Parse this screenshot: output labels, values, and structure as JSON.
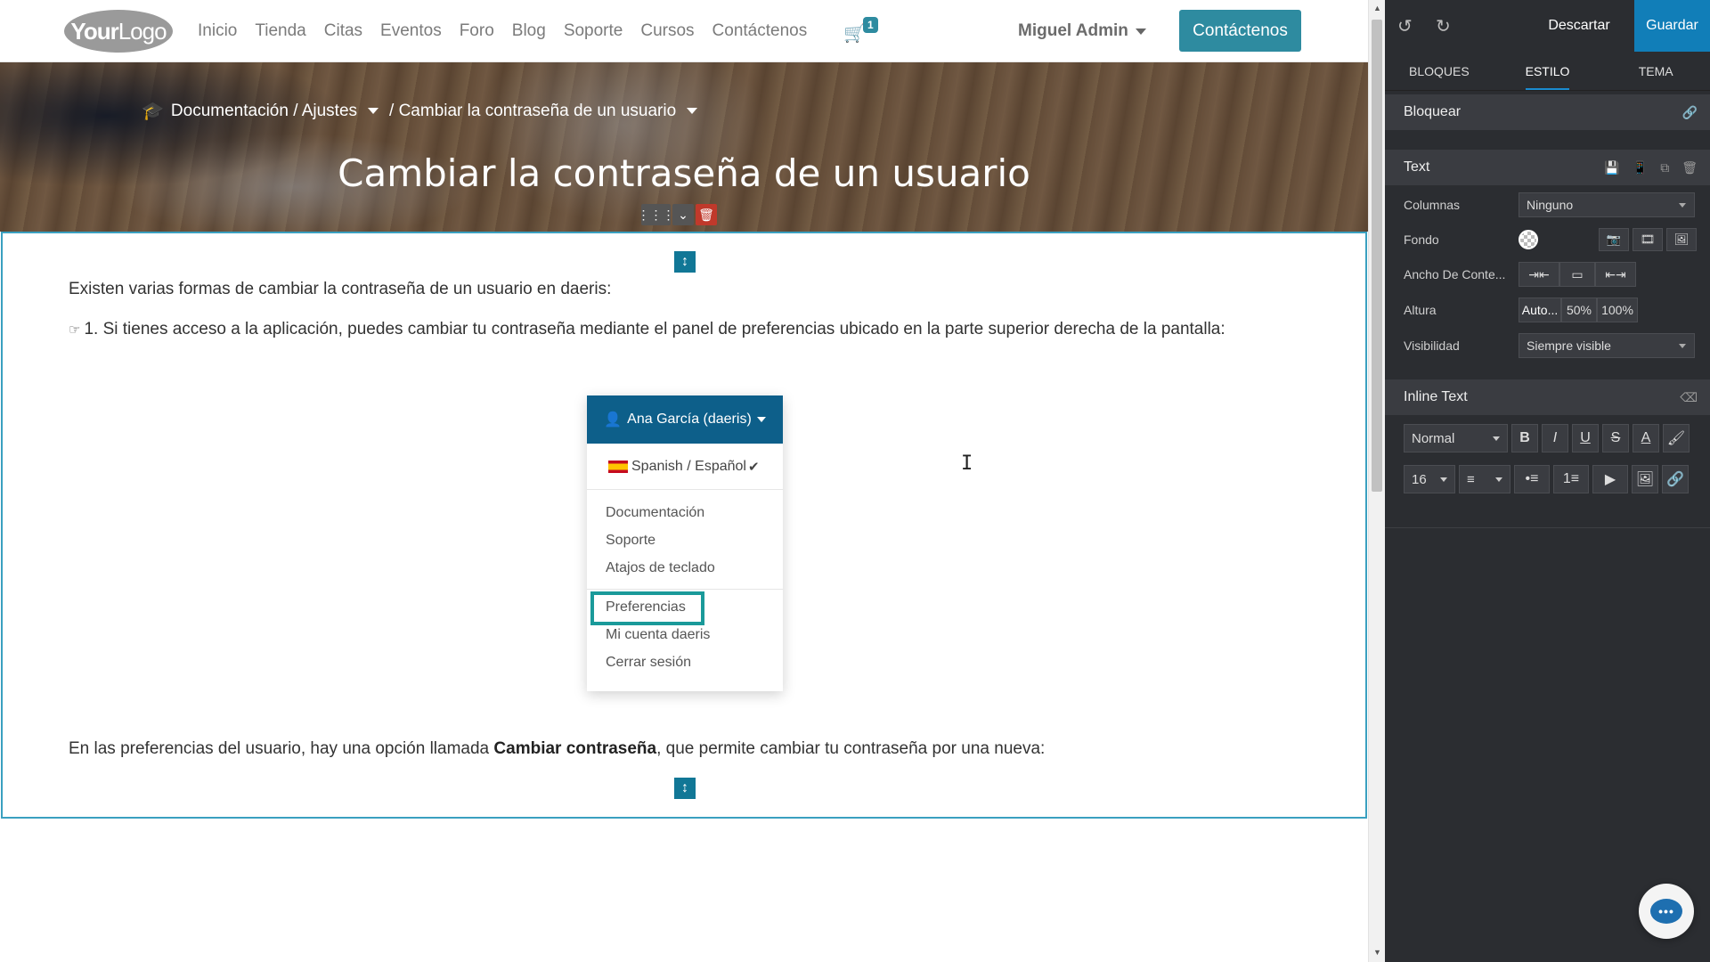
{
  "navbar": {
    "logo_text_bold": "Your",
    "logo_text_thin": "Logo",
    "links": [
      "Inicio",
      "Tienda",
      "Citas",
      "Eventos",
      "Foro",
      "Blog",
      "Soporte",
      "Cursos",
      "Contáctenos"
    ],
    "cart_count": "1",
    "user_name": "Miguel Admin",
    "contact_button": "Contáctenos"
  },
  "hero": {
    "breadcrumb_parent": "Documentación / Ajustes",
    "breadcrumb_current": "/ Cambiar la contraseña de un usuario",
    "title": "Cambiar la contraseña de un usuario"
  },
  "content": {
    "p1": "Existen varias formas de cambiar la contraseña de un usuario en daeris:",
    "p2": "1. Si tienes acceso a la aplicación, puedes cambiar tu contraseña mediante el panel de preferencias ubicado en la parte superior derecha de la pantalla:",
    "p3_before": "En las preferencias del usuario, hay una opción llamada ",
    "p3_bold": "Cambiar contraseña",
    "p3_after": ", que permite cambiar tu contraseña por una nueva:"
  },
  "illustration": {
    "user_label": "Ana García (daeris)",
    "language": "Spanish / Español",
    "items_group1": [
      "Documentación",
      "Soporte",
      "Atajos de teclado"
    ],
    "items_group2": [
      "Preferencias",
      "Mi cuenta daeris",
      "Cerrar sesión"
    ],
    "highlight_color": "#1a9a9a"
  },
  "editor": {
    "discard": "Descartar",
    "save": "Guardar",
    "tabs": [
      "BLOQUES",
      "ESTILO",
      "TEMA"
    ],
    "active_tab": "ESTILO",
    "section_block": "Bloquear",
    "section_text": "Text",
    "props": {
      "columns_label": "Columnas",
      "columns_value": "Ninguno",
      "background_label": "Fondo",
      "width_label": "Ancho De Conte...",
      "height_label": "Altura",
      "height_options": [
        "Auto...",
        "50%",
        "100%"
      ],
      "visibility_label": "Visibilidad",
      "visibility_value": "Siempre visible"
    },
    "section_inline": "Inline Text",
    "format_style": "Normal",
    "font_size": "16",
    "accent_color": "#117eb8"
  }
}
